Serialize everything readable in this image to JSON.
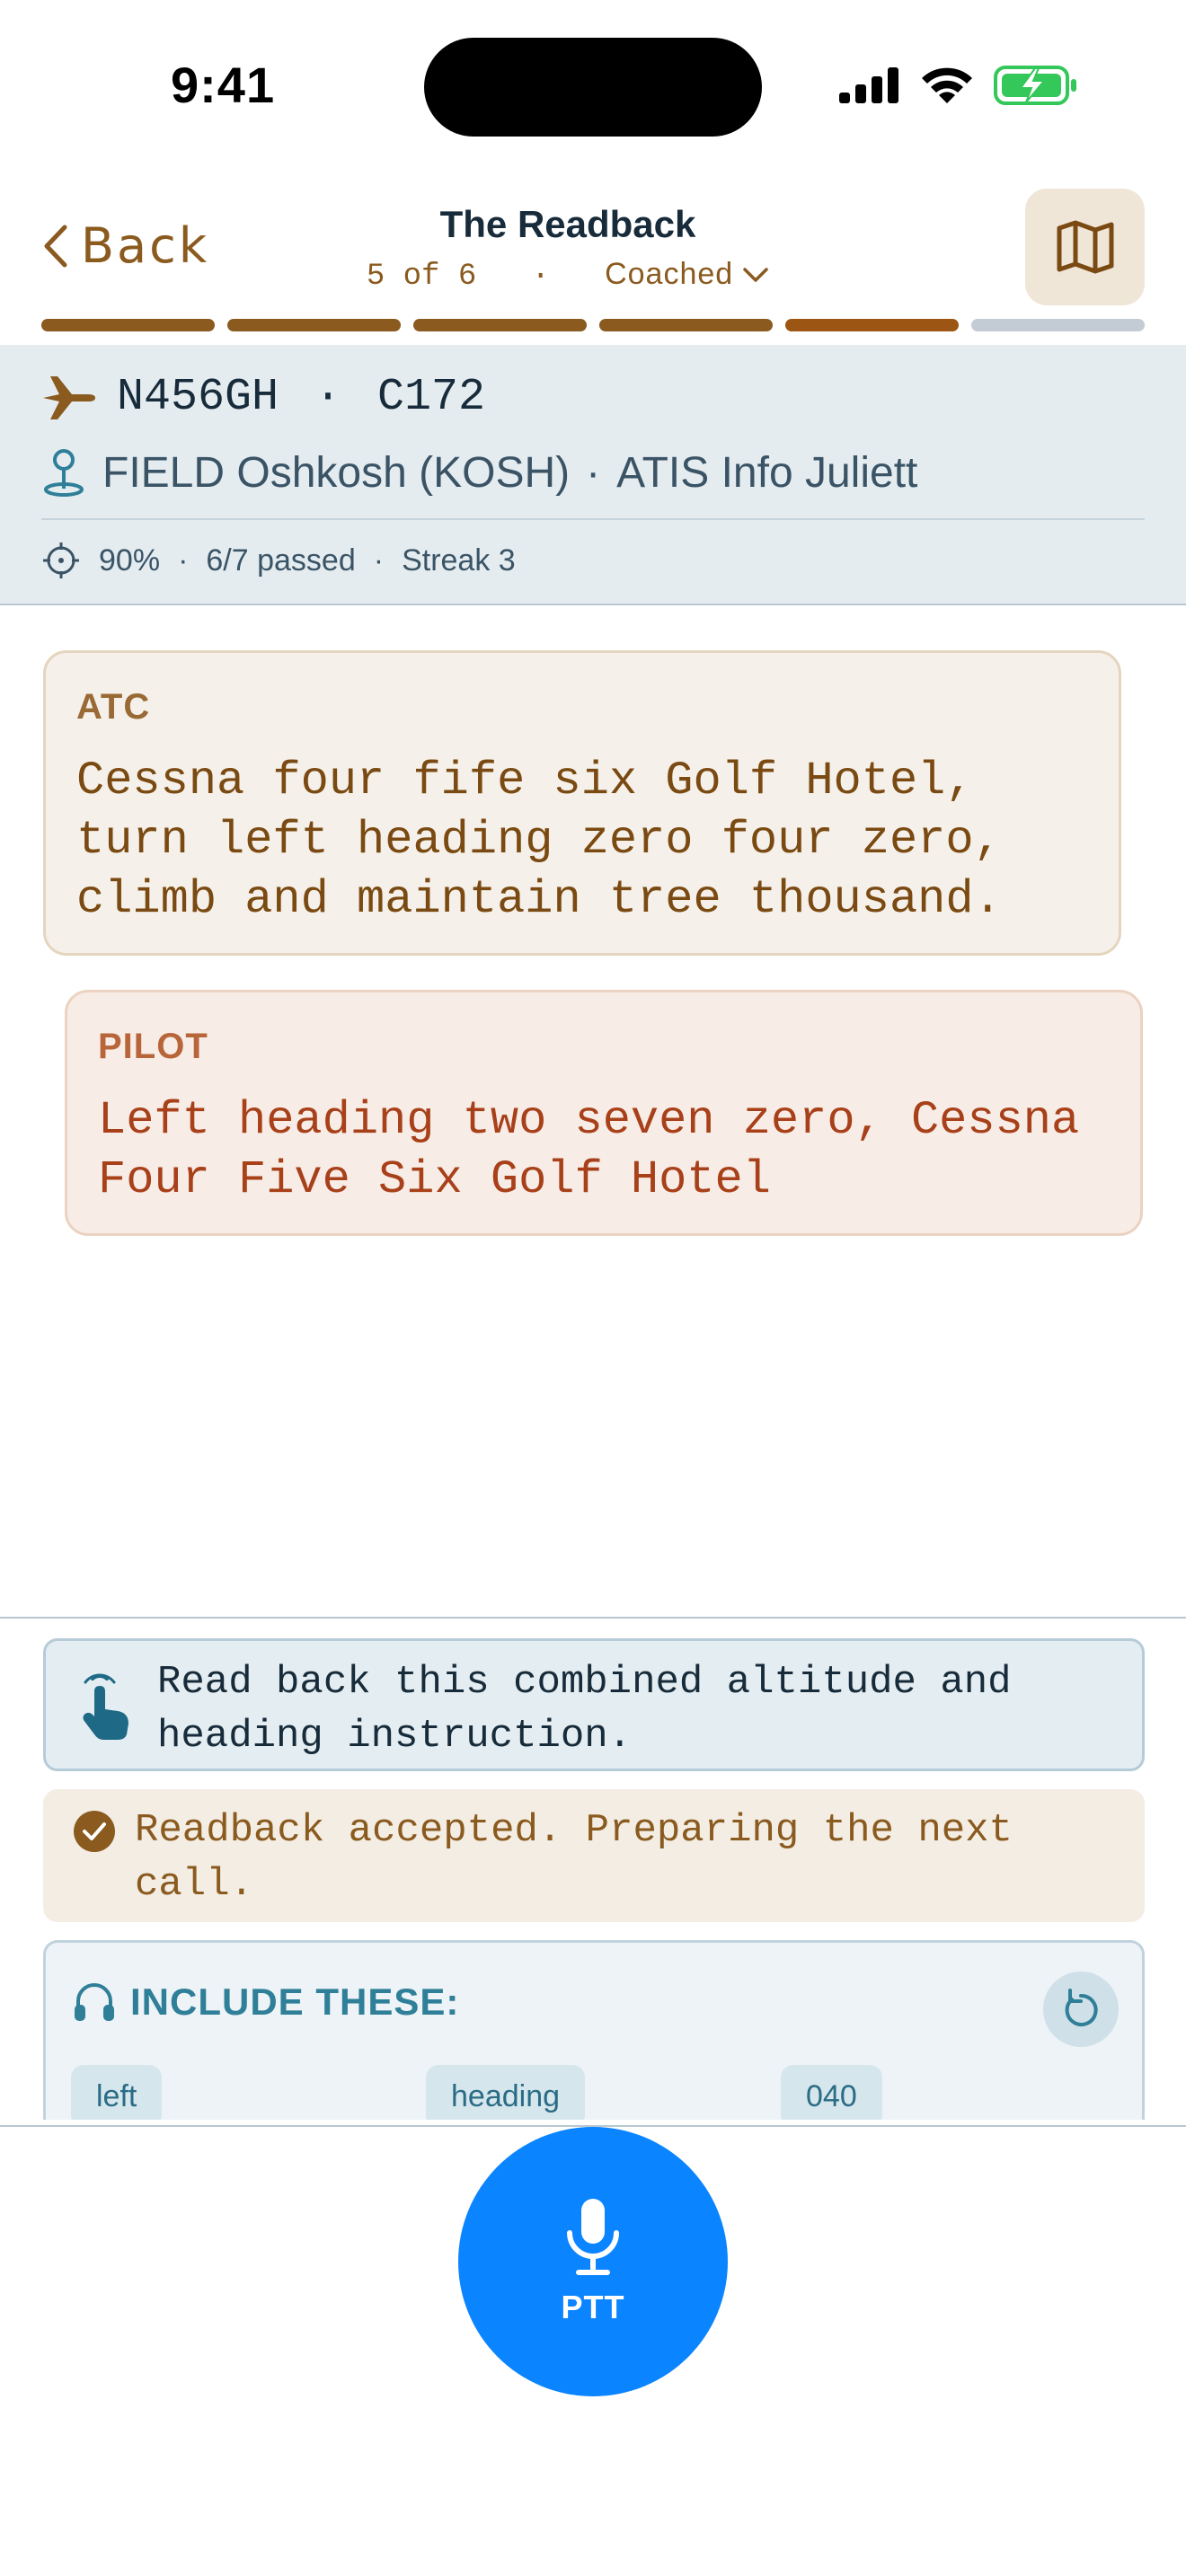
{
  "status_bar": {
    "time": "9:41"
  },
  "header": {
    "back_label": "Back",
    "title": "The Readback",
    "step": "5 of 6",
    "separator": "·",
    "mode": "Coached",
    "progress": {
      "total": 6,
      "completed": 4,
      "current": 5
    }
  },
  "flight": {
    "callsign": "N456GH",
    "dot": "·",
    "aircraft": "C172",
    "field": "FIELD Oshkosh (KOSH)",
    "field_sep": "·",
    "atis": "ATIS Info Juliett",
    "accuracy": "90%",
    "passed": "6/7 passed",
    "streak": "Streak 3",
    "stat_sep": "·"
  },
  "transcript": {
    "atc": {
      "speaker": "ATC",
      "text": "Cessna four fife six Golf Hotel, turn left heading zero four zero, climb and maintain tree thousand."
    },
    "pilot": {
      "speaker": "PILOT",
      "text": "Left heading two seven zero, Cessna Four Five Six Golf Hotel"
    }
  },
  "hint": {
    "text": "Read back this combined altitude and heading instruction."
  },
  "feedback": {
    "text": "Readback accepted. Preparing the next call."
  },
  "include": {
    "title": "INCLUDE THESE:",
    "chips": [
      "left",
      "heading",
      "040"
    ]
  },
  "ptt": {
    "label": "PTT"
  },
  "colors": {
    "accent_brown": "#8a5a1e",
    "ptt_blue": "#0a84ff",
    "teal": "#2f7f99",
    "battery_green": "#34c759"
  }
}
